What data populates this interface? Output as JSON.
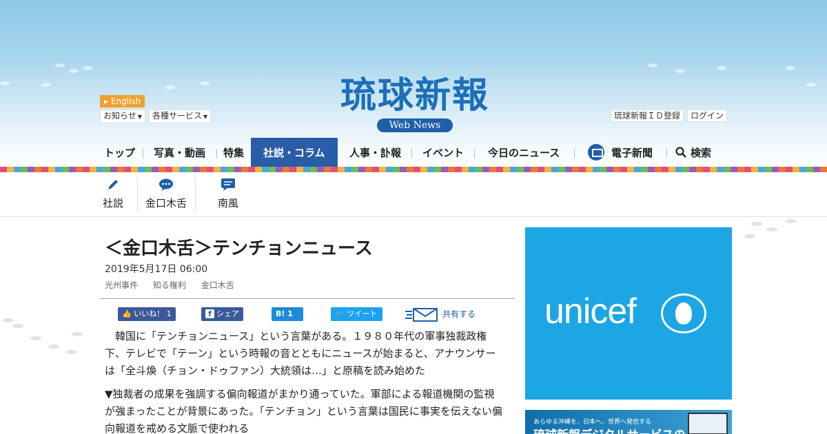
{
  "header": {
    "logo": "琉球新報",
    "subtitle": "Web News",
    "english_link": "English",
    "left_menus": [
      {
        "label": "お知らせ"
      },
      {
        "label": "各種サービス"
      }
    ],
    "right_links": [
      {
        "label": "琉球新報ＩＤ登録"
      },
      {
        "label": "ログイン"
      }
    ]
  },
  "nav": {
    "items": [
      {
        "label": "トップ"
      },
      {
        "label": "写真・動画"
      },
      {
        "label": "特集"
      },
      {
        "label": "社説・コラム",
        "active": true
      },
      {
        "label": "人事・訃報"
      },
      {
        "label": "イベント"
      },
      {
        "label": "今日のニュース"
      },
      {
        "label": "電子新聞"
      },
      {
        "label": "検索"
      }
    ],
    "active_color": "#2a5da8"
  },
  "subnav": {
    "items": [
      {
        "label": "社説",
        "icon": "pen-icon"
      },
      {
        "label": "金口木舌",
        "icon": "speech-bubble-icon"
      },
      {
        "label": "南風",
        "icon": "message-icon"
      }
    ]
  },
  "article": {
    "title": "＜金口木舌＞テンチョンニュース",
    "date": "2019年5月17日 06:00",
    "tags": [
      "光州事件",
      "知る権利",
      "金口木舌"
    ],
    "share": {
      "fb_like": "いいね！",
      "fb_like_count": "1",
      "fb_share": "シェア",
      "hatena_count": "1",
      "tweet": "ツイート",
      "share_all": "共有する"
    },
    "paragraphs": [
      "　韓国に「テンチョンニュース」という言葉がある。１９８０年代の軍事独裁政権下、テレビで「テーン」という時報の音とともにニュースが始まると、アナウンサーは「全斗煥（チョン・ドゥファン）大統領は…」と原稿を読み始めた",
      "▼独裁者の成果を強調する偏向報道がまかり通っていた。軍部による報道機関の監視が強まったことが背景にあった。「テンチョン」という言葉は国民に事実を伝えない偏向報道を戒める文脈で使われる"
    ]
  },
  "sidebar": {
    "unicef_ad": {
      "text": "unicef",
      "bg_color": "#1ca6e4"
    },
    "ad2": {
      "line1": "あらゆる沖縄を、日本へ、世界へ発信する",
      "line2": "琉球新報デジタルサービスの"
    }
  }
}
